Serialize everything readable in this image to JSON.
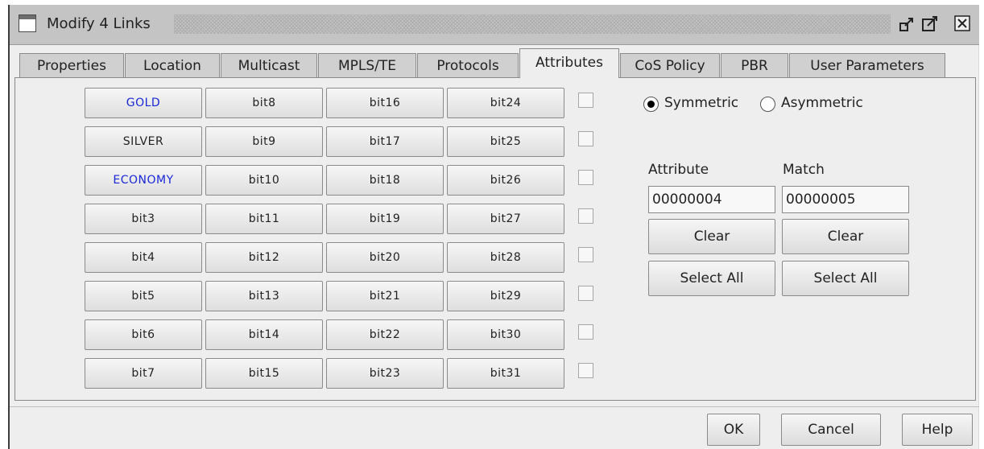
{
  "window": {
    "title": "Modify 4 Links",
    "icons": [
      "window-icon",
      "minimize-icon",
      "maximize-icon",
      "close-icon"
    ]
  },
  "tabs": [
    {
      "label": "Properties",
      "active": false
    },
    {
      "label": "Location",
      "active": false
    },
    {
      "label": "Multicast",
      "active": false
    },
    {
      "label": "MPLS/TE",
      "active": false
    },
    {
      "label": "Protocols",
      "active": false
    },
    {
      "label": "Attributes",
      "active": true
    },
    {
      "label": "CoS Policy",
      "active": false
    },
    {
      "label": "PBR",
      "active": false
    },
    {
      "label": "User Parameters",
      "active": false
    }
  ],
  "attributes": {
    "columns": [
      [
        {
          "label": "GOLD",
          "checked": false,
          "enabled": true,
          "color": "#1a28d6"
        },
        {
          "label": "SILVER",
          "checked": false,
          "enabled": false
        },
        {
          "label": "ECONOMY",
          "checked": true,
          "enabled": true,
          "color": "#1a28d6"
        },
        {
          "label": "bit3",
          "checked": false,
          "enabled": false
        },
        {
          "label": "bit4",
          "checked": false,
          "enabled": false
        },
        {
          "label": "bit5",
          "checked": false,
          "enabled": false
        },
        {
          "label": "bit6",
          "checked": false,
          "enabled": false
        },
        {
          "label": "bit7",
          "checked": false,
          "enabled": false
        }
      ],
      [
        {
          "label": "bit8",
          "checked": false,
          "enabled": false
        },
        {
          "label": "bit9",
          "checked": false,
          "enabled": false
        },
        {
          "label": "bit10",
          "checked": false,
          "enabled": false
        },
        {
          "label": "bit11",
          "checked": false,
          "enabled": false
        },
        {
          "label": "bit12",
          "checked": false,
          "enabled": false
        },
        {
          "label": "bit13",
          "checked": false,
          "enabled": false
        },
        {
          "label": "bit14",
          "checked": false,
          "enabled": false
        },
        {
          "label": "bit15",
          "checked": false,
          "enabled": false
        }
      ],
      [
        {
          "label": "bit16",
          "checked": false,
          "enabled": false
        },
        {
          "label": "bit17",
          "checked": false,
          "enabled": false
        },
        {
          "label": "bit18",
          "checked": false,
          "enabled": false
        },
        {
          "label": "bit19",
          "checked": false,
          "enabled": false
        },
        {
          "label": "bit20",
          "checked": false,
          "enabled": false
        },
        {
          "label": "bit21",
          "checked": false,
          "enabled": false
        },
        {
          "label": "bit22",
          "checked": false,
          "enabled": false
        },
        {
          "label": "bit23",
          "checked": false,
          "enabled": false
        }
      ],
      [
        {
          "label": "bit24",
          "checked": false,
          "enabled": false
        },
        {
          "label": "bit25",
          "checked": false,
          "enabled": false
        },
        {
          "label": "bit26",
          "checked": false,
          "enabled": false
        },
        {
          "label": "bit27",
          "checked": false,
          "enabled": false
        },
        {
          "label": "bit28",
          "checked": false,
          "enabled": false
        },
        {
          "label": "bit29",
          "checked": false,
          "enabled": false
        },
        {
          "label": "bit30",
          "checked": false,
          "enabled": false
        },
        {
          "label": "bit31",
          "checked": false,
          "enabled": false
        }
      ]
    ]
  },
  "mode": {
    "symmetric_label": "Symmetric",
    "asymmetric_label": "Asymmetric",
    "selected": "Symmetric"
  },
  "attribute_panel": {
    "attribute_label": "Attribute",
    "match_label": "Match",
    "attribute_value": "00000004",
    "match_value": "00000005",
    "clear_label": "Clear",
    "select_all_label": "Select All"
  },
  "footer": {
    "ok_label": "OK",
    "cancel_label": "Cancel",
    "help_label": "Help"
  }
}
